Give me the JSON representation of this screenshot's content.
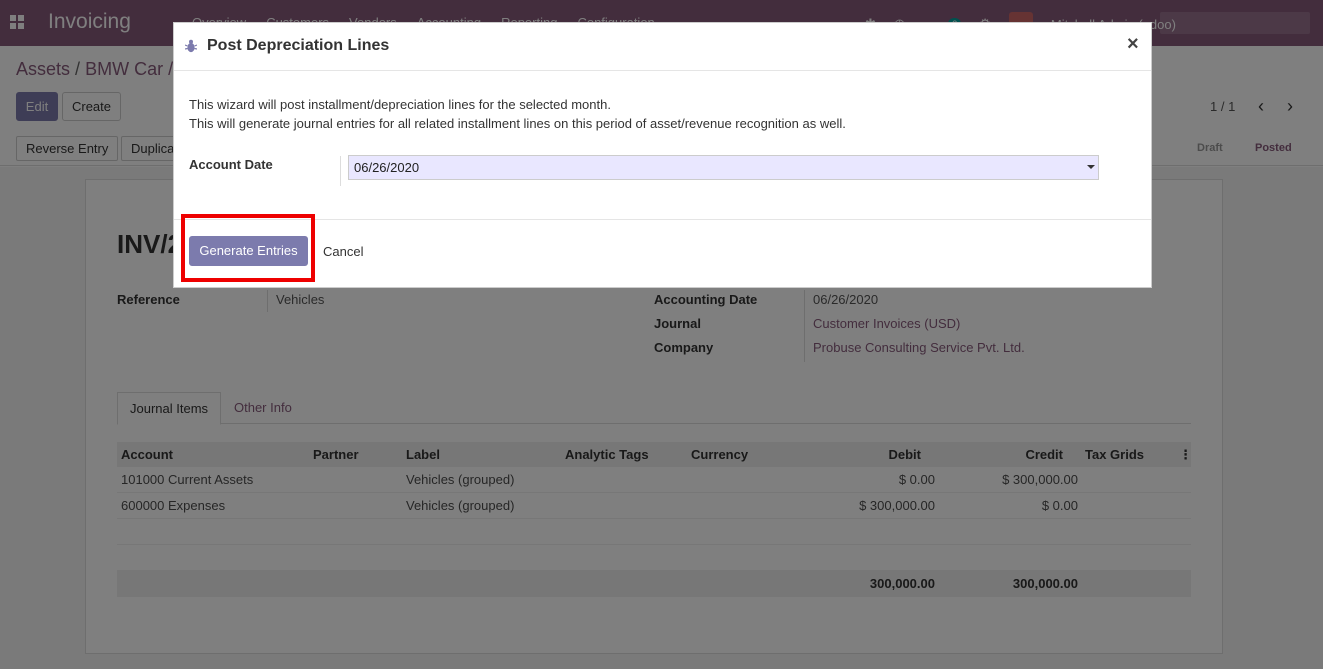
{
  "navbar": {
    "app_name": "Invoicing",
    "menu": [
      "Overview",
      "Customers",
      "Vendors",
      "Accounting",
      "Reporting",
      "Configuration"
    ],
    "message_count": "3",
    "user_name": "Mitchell Admin (odoo)"
  },
  "breadcrumb": {
    "root": "Assets",
    "separator": "/",
    "current": "BMW Car /"
  },
  "actions": {
    "edit": "Edit",
    "create": "Create"
  },
  "pager": {
    "value": "1 / 1"
  },
  "statusbar": {
    "reverse_entry": "Reverse Entry",
    "duplicate": "Duplicate",
    "steps": [
      "Draft",
      "Posted"
    ],
    "active_step": "Posted"
  },
  "entry": {
    "title_partial": "INV/2",
    "reference_label": "Reference",
    "reference_value": "Vehicles",
    "accounting_date_label": "Accounting Date",
    "accounting_date_value": "06/26/2020",
    "journal_label": "Journal",
    "journal_value": "Customer Invoices (USD)",
    "company_label": "Company",
    "company_value": "Probuse Consulting Service Pvt. Ltd."
  },
  "tabs": [
    "Journal Items",
    "Other Info"
  ],
  "journal_items": {
    "columns": [
      "Account",
      "Partner",
      "Label",
      "Analytic Tags",
      "Currency",
      "Debit",
      "Credit",
      "Tax Grids"
    ],
    "rows": [
      {
        "account": "101000 Current Assets",
        "partner": "",
        "label": "Vehicles (grouped)",
        "tags": "",
        "currency": "",
        "debit": "$ 0.00",
        "credit": "$ 300,000.00",
        "tax": ""
      },
      {
        "account": "600000 Expenses",
        "partner": "",
        "label": "Vehicles (grouped)",
        "tags": "",
        "currency": "",
        "debit": "$ 300,000.00",
        "credit": "$ 0.00",
        "tax": ""
      }
    ],
    "total_debit": "300,000.00",
    "total_credit": "300,000.00"
  },
  "dialog": {
    "title": "Post Depreciation Lines",
    "close": "×",
    "line1": "This wizard will post installment/depreciation lines for the selected month.",
    "line2": "This will generate journal entries for all related installment lines on this period of asset/revenue recognition as well.",
    "account_date_label": "Account Date",
    "account_date_value": "06/26/2020",
    "generate_button": "Generate Entries",
    "cancel_button": "Cancel"
  },
  "colors": {
    "navbar": "#875a7b",
    "primary_button": "#7c7bad",
    "highlight": "#ee0000",
    "date_field_bg": "#e9e7ff"
  }
}
